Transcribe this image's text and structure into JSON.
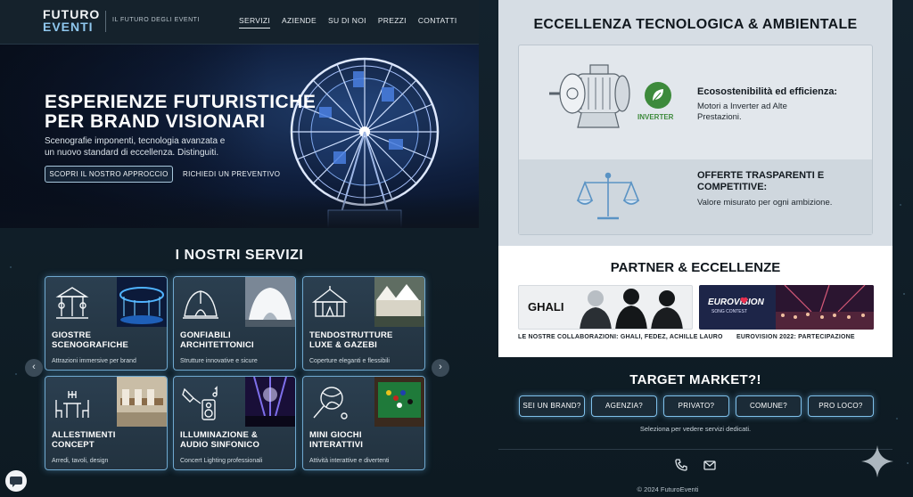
{
  "header": {
    "logo_top": "FUTURO",
    "logo_bottom": "EVENTI",
    "tagline": "IL FUTURO DEGLI EVENTI",
    "nav": [
      "SERVIZI",
      "AZIENDE",
      "SU DI NOI",
      "PREZZI",
      "CONTATTI"
    ],
    "active_nav": "SERVIZI"
  },
  "hero": {
    "title_line1": "ESPERIENZE FUTURISTICHE",
    "title_line2": "PER BRAND VISIONARI",
    "subtitle_line1": "Scenografie imponenti, tecnologia avanzata e",
    "subtitle_line2": "un nuovo standard di eccellenza. Distinguiti.",
    "primary_button": "SCOPRI IL NOSTRO APPROCCIO",
    "secondary_link": "RICHIEDI UN PREVENTIVO"
  },
  "services": {
    "title": "I NOSTRI SERVIZI",
    "cards": [
      {
        "title1": "GIOSTRE",
        "title2": "SCENOGRAFICHE",
        "desc": "Attrazioni immersive per brand",
        "icon": "carousel-icon"
      },
      {
        "title1": "GONFIABILI",
        "title2": "ARCHITETTONICI",
        "desc": "Strutture innovative e sicure",
        "icon": "dome-tent-icon"
      },
      {
        "title1": "TENDOSTRUTTURE",
        "title2": "LUXE & GAZEBI",
        "desc": "Coperture eleganti e flessibili",
        "icon": "circus-tent-icon"
      },
      {
        "title1": "ALLESTIMENTI",
        "title2": "CONCEPT",
        "desc": "Arredi, tavoli, design",
        "icon": "table-chairs-icon"
      },
      {
        "title1": "ILLUMINAZIONE &",
        "title2": "AUDIO SINFONICO",
        "desc": "Concert Lighting professionali",
        "icon": "spotlight-speaker-icon"
      },
      {
        "title1": "MINI GIOCHI",
        "title2": "INTERATTIVI",
        "desc": "Attività interattive e divertenti",
        "icon": "ball-racket-icon"
      }
    ],
    "prev_arrow": "‹",
    "next_arrow": "›"
  },
  "eccellenza": {
    "title": "ECCELLENZA TECNOLOGICA & AMBIENTALE",
    "feature1_title": "Ecosostenibilità ed efficienza:",
    "feature1_desc_line1": "Motori a Inverter ad Alte",
    "feature1_desc_line2": "Prestazioni.",
    "inverter_label": "INVERTER",
    "feature2_title_line1": "OFFERTE TRASPARENTI E",
    "feature2_title_line2": "COMPETITIVE:",
    "feature2_desc": "Valore misurato per ogni ambizione."
  },
  "partners": {
    "title": "PARTNER & ECCELLENZE",
    "card1_label": "GHALI",
    "card2_label_line1": "EUROVISION",
    "card2_label_line2": "SONG CONTEST",
    "caption1": "LE NOSTRE COLLABORAZIONI: GHALI, FEDEZ, ACHILLE LAURO",
    "caption2": "EUROVISION 2022: PARTECIPAZIONE"
  },
  "target": {
    "title": "TARGET MARKET?!",
    "buttons": [
      "SEI UN BRAND?",
      "AGENZIA?",
      "PRIVATO?",
      "COMUNE?",
      "PRO LOCO?"
    ],
    "hint": "Seleziona per vedere servizi dedicati."
  },
  "footer": {
    "copyright": "© 2024 FuturoEventi"
  },
  "colors": {
    "background": "#0e1820",
    "accent": "#7fc0ea",
    "panel_light": "#d6dde4"
  }
}
